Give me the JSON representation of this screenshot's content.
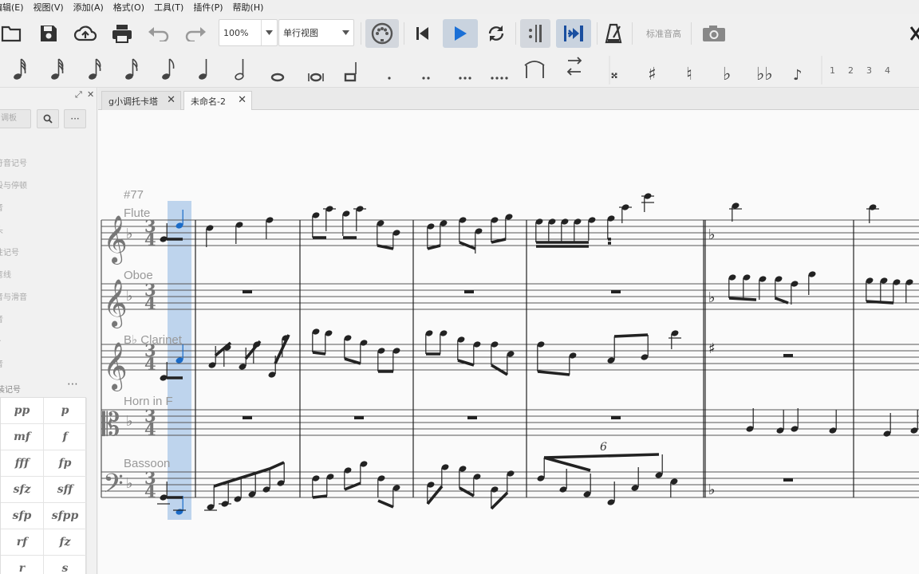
{
  "menu": [
    "编辑(E)",
    "视图(V)",
    "添加(A)",
    "格式(O)",
    "工具(T)",
    "插件(P)",
    "帮助(H)"
  ],
  "toolbar": {
    "zoom": "100%",
    "view_mode": "单行视图",
    "concert_pitch": "标准音高"
  },
  "note_input": {
    "voices": [
      "1",
      "2",
      "3",
      "4"
    ]
  },
  "palette": {
    "search_placeholder": "调板",
    "search_icon": "search-icon",
    "more_label": "···",
    "items": [
      "符音记号",
      "段与停顿",
      "音",
      "头",
      "性记号",
      "弯线",
      "音与滑音",
      "音",
      "A",
      "音"
    ],
    "dynamics_title": "装记号",
    "dynamics": [
      "pp",
      "p",
      "mf",
      "f",
      "fff",
      "fp",
      "sfz",
      "sff",
      "sfp",
      "sfpp",
      "rf",
      "fz",
      "r",
      "s"
    ]
  },
  "tabs": [
    {
      "label": "g小调托卡塔"
    },
    {
      "label": "未命名-2"
    }
  ],
  "score": {
    "rehearsal": "#77",
    "instruments": [
      "Flute",
      "Oboe",
      "B♭ Clarinet",
      "Horn in F",
      "Bassoon"
    ],
    "time_signature": {
      "top": "3",
      "bottom": "4"
    },
    "tuplet": "6"
  },
  "colors": {
    "selection": "#a9c7e8",
    "selected_note": "#1a6bc8",
    "pressed_button": "#c9d3df",
    "play_icon": "#1a6fd6"
  }
}
